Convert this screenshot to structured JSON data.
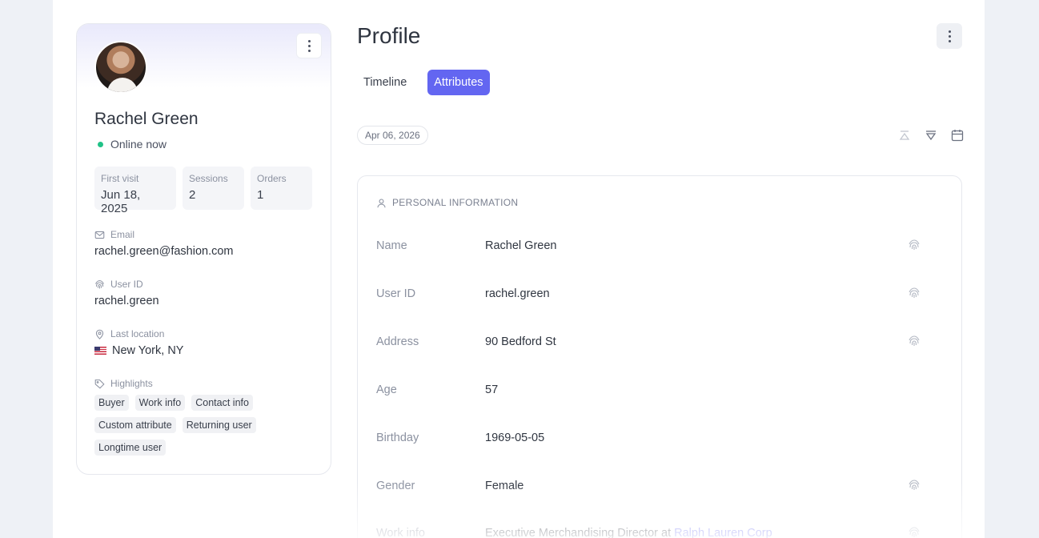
{
  "profile": {
    "name": "Rachel Green",
    "status": "Online now",
    "stats": [
      {
        "label": "First visit",
        "value": "Jun 18, 2025"
      },
      {
        "label": "Sessions",
        "value": "2"
      },
      {
        "label": "Orders",
        "value": "1"
      }
    ],
    "email_label": "Email",
    "email": "rachel.green@fashion.com",
    "userid_label": "User ID",
    "userid": "rachel.green",
    "location_label": "Last location",
    "location": "New York, NY",
    "highlights_label": "Highlights",
    "tags": [
      "Buyer",
      "Work info",
      "Contact info",
      "Custom attribute",
      "Returning user",
      "Longtime user"
    ]
  },
  "main": {
    "title": "Profile",
    "tabs": [
      {
        "label": "Timeline",
        "active": false
      },
      {
        "label": "Attributes",
        "active": true
      }
    ],
    "date": "Apr 06, 2026",
    "section_title": "PERSONAL INFORMATION",
    "rows": [
      {
        "key": "Name",
        "value": "Rachel Green",
        "identifier": true
      },
      {
        "key": "User ID",
        "value": "rachel.green",
        "identifier": true
      },
      {
        "key": "Address",
        "value": "90 Bedford St",
        "identifier": true
      },
      {
        "key": "Age",
        "value": "57",
        "identifier": false
      },
      {
        "key": "Birthday",
        "value": "1969-05-05",
        "identifier": false
      },
      {
        "key": "Gender",
        "value": "Female",
        "identifier": true
      },
      {
        "key": "Work info",
        "value": "Executive Merchandising Director at ",
        "link": "Ralph Lauren Corp",
        "identifier": true
      }
    ]
  },
  "colors": {
    "accent": "#6366f1",
    "online": "#21c287"
  }
}
